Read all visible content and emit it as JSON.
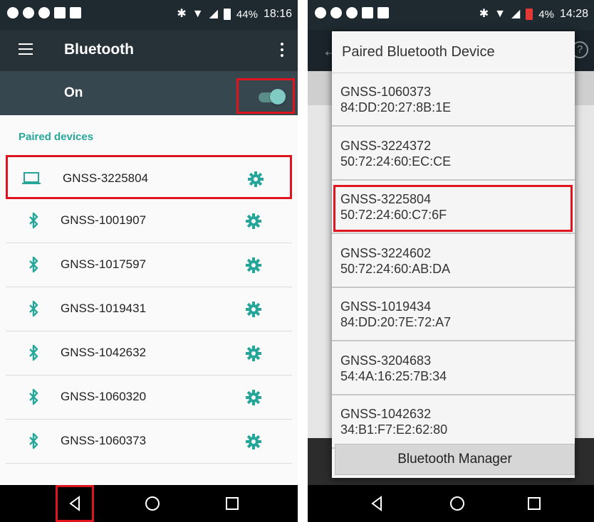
{
  "left": {
    "status": {
      "battery": "44%",
      "time": "18:16"
    },
    "toolbar": {
      "title": "Bluetooth"
    },
    "toggle": {
      "label": "On",
      "state": "on"
    },
    "section_header": "Paired devices",
    "devices": [
      {
        "name": "GNSS-3225804",
        "icon": "laptop-icon"
      },
      {
        "name": "GNSS-1001907",
        "icon": "bluetooth-icon"
      },
      {
        "name": "GNSS-1017597",
        "icon": "bluetooth-icon"
      },
      {
        "name": "GNSS-1019431",
        "icon": "bluetooth-icon"
      },
      {
        "name": "GNSS-1042632",
        "icon": "bluetooth-icon"
      },
      {
        "name": "GNSS-1060320",
        "icon": "bluetooth-icon"
      },
      {
        "name": "GNSS-1060373",
        "icon": "bluetooth-icon"
      }
    ]
  },
  "right": {
    "status": {
      "battery": "4%",
      "time": "14:28"
    },
    "dialog": {
      "title": "Paired Bluetooth Device",
      "items": [
        {
          "name": "GNSS-1060373",
          "mac": "84:DD:20:27:8B:1E"
        },
        {
          "name": "GNSS-3224372",
          "mac": "50:72:24:60:EC:CE"
        },
        {
          "name": "GNSS-3225804",
          "mac": "50:72:24:60:C7:6F"
        },
        {
          "name": "GNSS-3224602",
          "mac": "50:72:24:60:AB:DA"
        },
        {
          "name": "GNSS-1019434",
          "mac": "84:DD:20:7E:72:A7"
        },
        {
          "name": "GNSS-3204683",
          "mac": "54:4A:16:25:7B:34"
        },
        {
          "name": "GNSS-1042632",
          "mac": "34:B1:F7:E2:62:80"
        }
      ],
      "button": "Bluetooth Manager"
    }
  },
  "colors": {
    "accent": "#26a69a",
    "highlight": "#e0141e",
    "toolbar": "#263238"
  }
}
